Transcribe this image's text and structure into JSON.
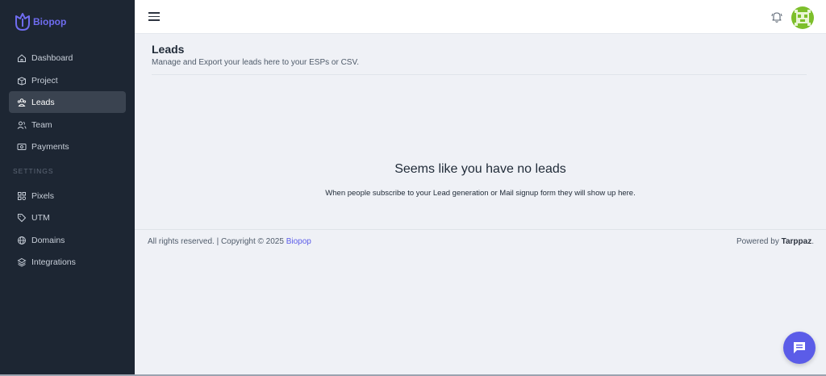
{
  "brand": {
    "name": "Biopop",
    "color": "#6f6cf0"
  },
  "sidebar": {
    "items": [
      {
        "label": "Dashboard",
        "icon": "home-icon",
        "active": false
      },
      {
        "label": "Project",
        "icon": "box-icon",
        "active": false
      },
      {
        "label": "Leads",
        "icon": "leads-icon",
        "active": true
      },
      {
        "label": "Team",
        "icon": "users-icon",
        "active": false
      },
      {
        "label": "Payments",
        "icon": "payments-icon",
        "active": false
      }
    ],
    "settings_label": "SETTINGS",
    "settings_items": [
      {
        "label": "Pixels",
        "icon": "pixels-icon"
      },
      {
        "label": "UTM",
        "icon": "tag-icon"
      },
      {
        "label": "Domains",
        "icon": "globe-icon"
      },
      {
        "label": "Integrations",
        "icon": "layers-icon"
      }
    ]
  },
  "topbar": {
    "menu_icon": "hamburger-icon",
    "notification_icon": "bell-icon",
    "avatar_icon": "avatar-icon"
  },
  "page": {
    "title": "Leads",
    "subtitle": "Manage and Export your leads here to your ESPs or CSV."
  },
  "empty_state": {
    "title": "Seems like you have no leads",
    "description": "When people subscribe to your Lead generation or Mail signup form they will show up here."
  },
  "footer": {
    "left_text": "All rights reserved. | Copyright © 2025 ",
    "left_link": "Biopop",
    "powered_by": "Powered by ",
    "powered_brand": "Tarppaz",
    "powered_suffix": "."
  },
  "chat": {
    "icon": "chat-icon"
  },
  "colors": {
    "sidebar_bg": "#1d2633",
    "accent": "#5b5ce8",
    "page_bg": "#eff1f6"
  }
}
